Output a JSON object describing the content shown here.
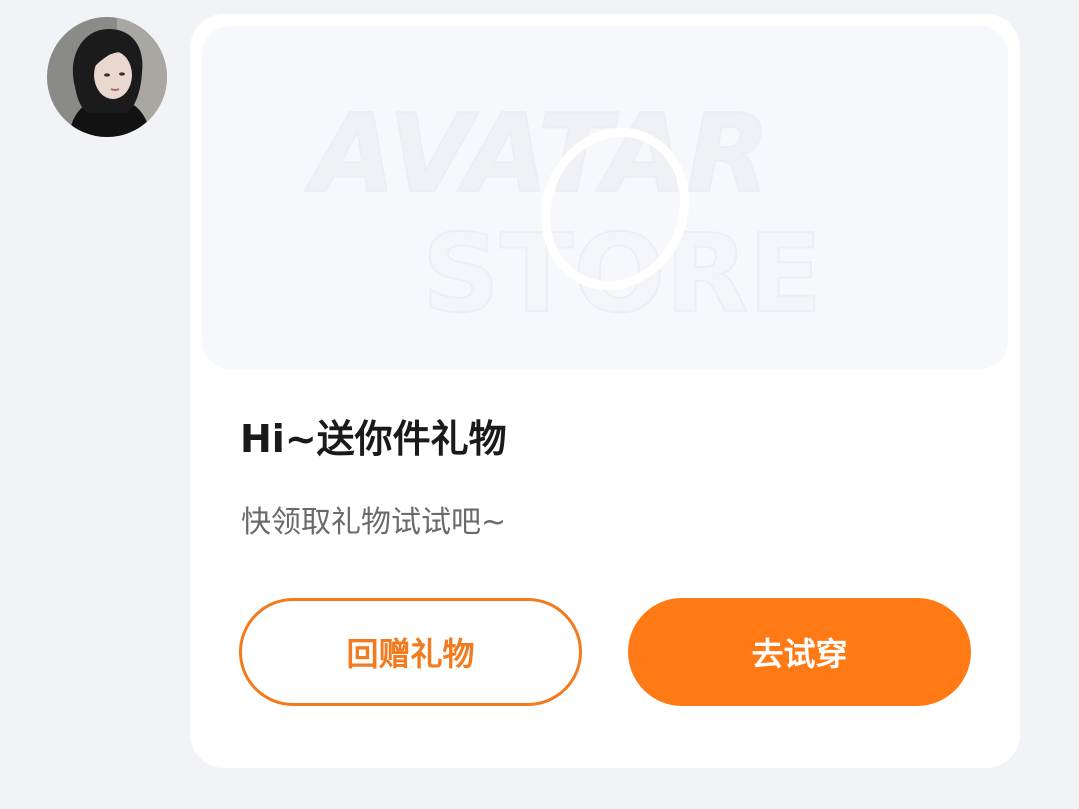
{
  "sender": {
    "avatar_alt": "avatar"
  },
  "banner": {
    "watermark_line1": "AVATAR",
    "watermark_line2": "STORE"
  },
  "message": {
    "title": "Hi~送你件礼物",
    "subtitle": "快领取礼物试试吧~"
  },
  "actions": {
    "return_gift_label": "回赠礼物",
    "try_on_label": "去试穿"
  },
  "colors": {
    "accent": "#ff7a14",
    "accent_outline": "#f27a1f",
    "background": "#f2f3f7",
    "card": "#ffffff"
  }
}
